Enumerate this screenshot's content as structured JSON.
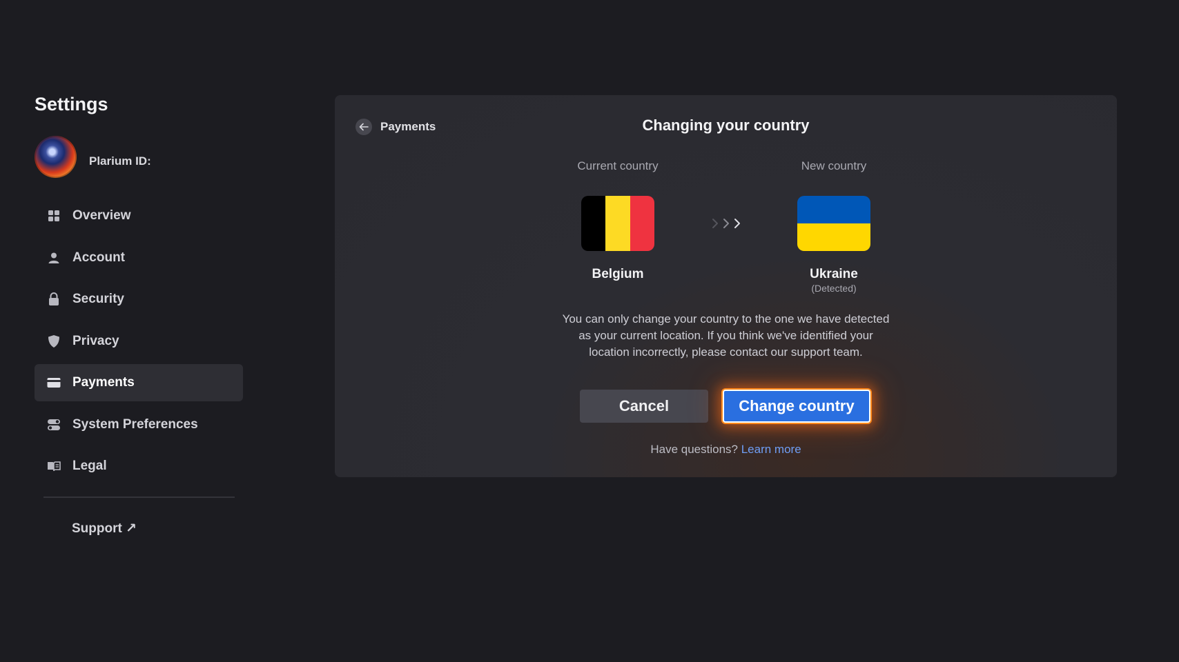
{
  "sidebar": {
    "title": "Settings",
    "plarium_id_label": "Plarium ID:",
    "items": [
      {
        "label": "Overview",
        "icon": "grid-icon"
      },
      {
        "label": "Account",
        "icon": "user-icon"
      },
      {
        "label": "Security",
        "icon": "lock-icon"
      },
      {
        "label": "Privacy",
        "icon": "shield-icon"
      },
      {
        "label": "Payments",
        "icon": "card-icon",
        "active": true
      },
      {
        "label": "System Preferences",
        "icon": "toggles-icon"
      },
      {
        "label": "Legal",
        "icon": "book-icon"
      }
    ],
    "support_label": "Support ↗"
  },
  "panel": {
    "back_label": "Payments",
    "title": "Changing your country",
    "current_label": "Current country",
    "new_label": "New country",
    "current_country": "Belgium",
    "new_country": "Ukraine",
    "new_country_note": "(Detected)",
    "info_lines": [
      "You can only change your country to the one we have detected",
      "as your current location. If you think we've identified your",
      "location incorrectly, please contact our support team."
    ],
    "cancel_label": "Cancel",
    "change_label": "Change country",
    "help_text": "Have questions?",
    "help_link": "Learn more"
  },
  "colors": {
    "background": "#1c1c21",
    "panel": "#2a2a30",
    "accent_button": "#2a6fe0",
    "glow": "#ff8a1c",
    "link": "#6f9ef5",
    "belgium": [
      "#000000",
      "#fdda24",
      "#ef3340"
    ],
    "ukraine": [
      "#0057b7",
      "#ffd700"
    ]
  }
}
